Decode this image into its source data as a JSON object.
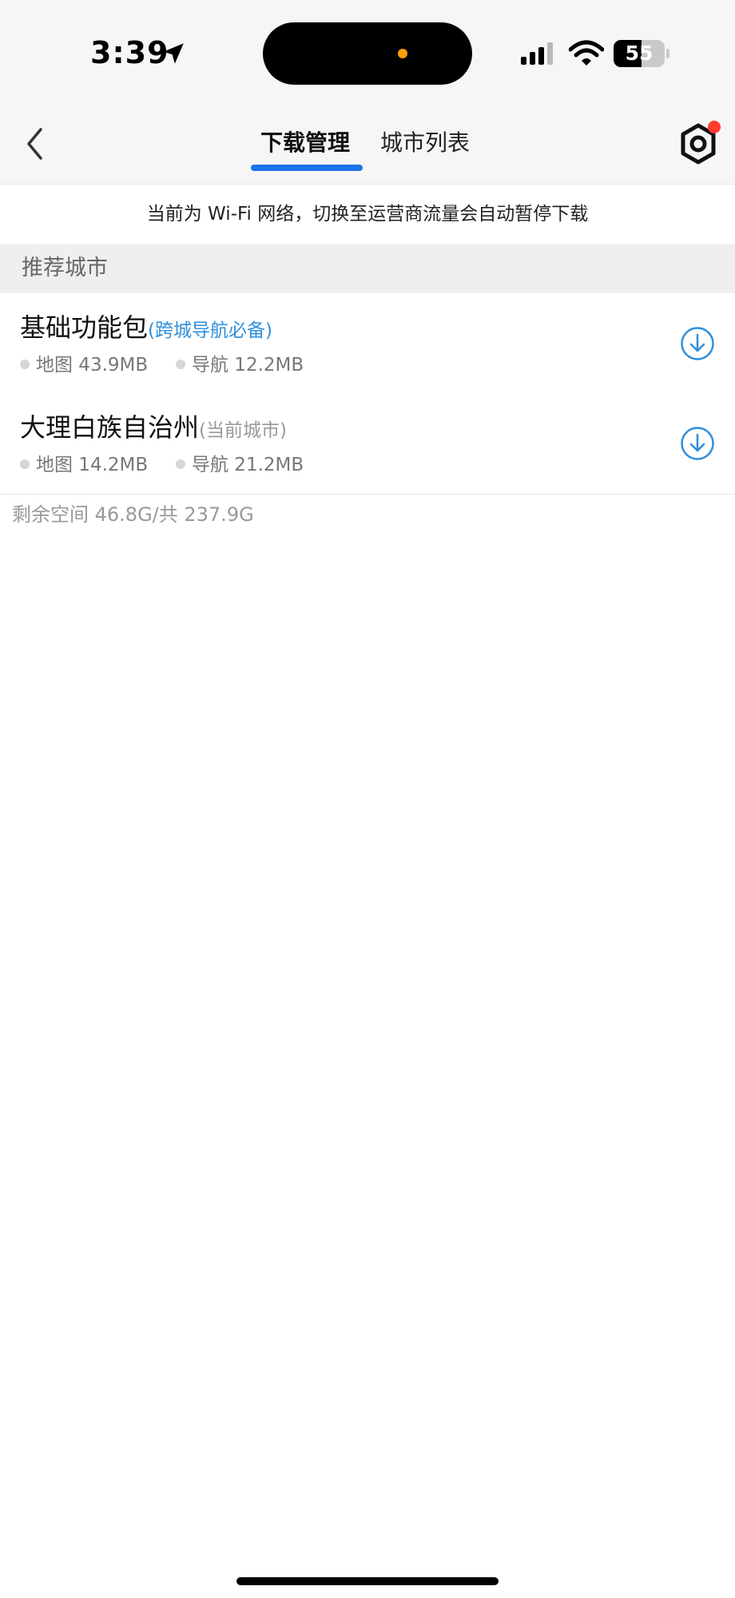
{
  "status_bar": {
    "time": "3:39",
    "battery_level": "55",
    "battery_fraction": 0.55
  },
  "nav": {
    "tabs": [
      {
        "label": "下载管理",
        "active": true
      },
      {
        "label": "城市列表",
        "active": false
      }
    ],
    "accent_color": "#1a73e8",
    "has_notification": true
  },
  "notice": {
    "text": "当前为 Wi-Fi 网络，切换至运营商流量会自动暂停下载"
  },
  "section": {
    "title": "推荐城市"
  },
  "items": [
    {
      "name": "基础功能包",
      "tag": "(跨城导航必备)",
      "map_size": "地图 43.9MB",
      "nav_size": "导航 12.2MB",
      "icon": "download-icon"
    },
    {
      "name": "大理白族自治州",
      "tag": "(当前城市)",
      "map_size": "地图 14.2MB",
      "nav_size": "导航 21.2MB",
      "icon": "download-icon"
    }
  ],
  "storage": {
    "text": "剩余空间 46.8G/共 237.9G"
  }
}
